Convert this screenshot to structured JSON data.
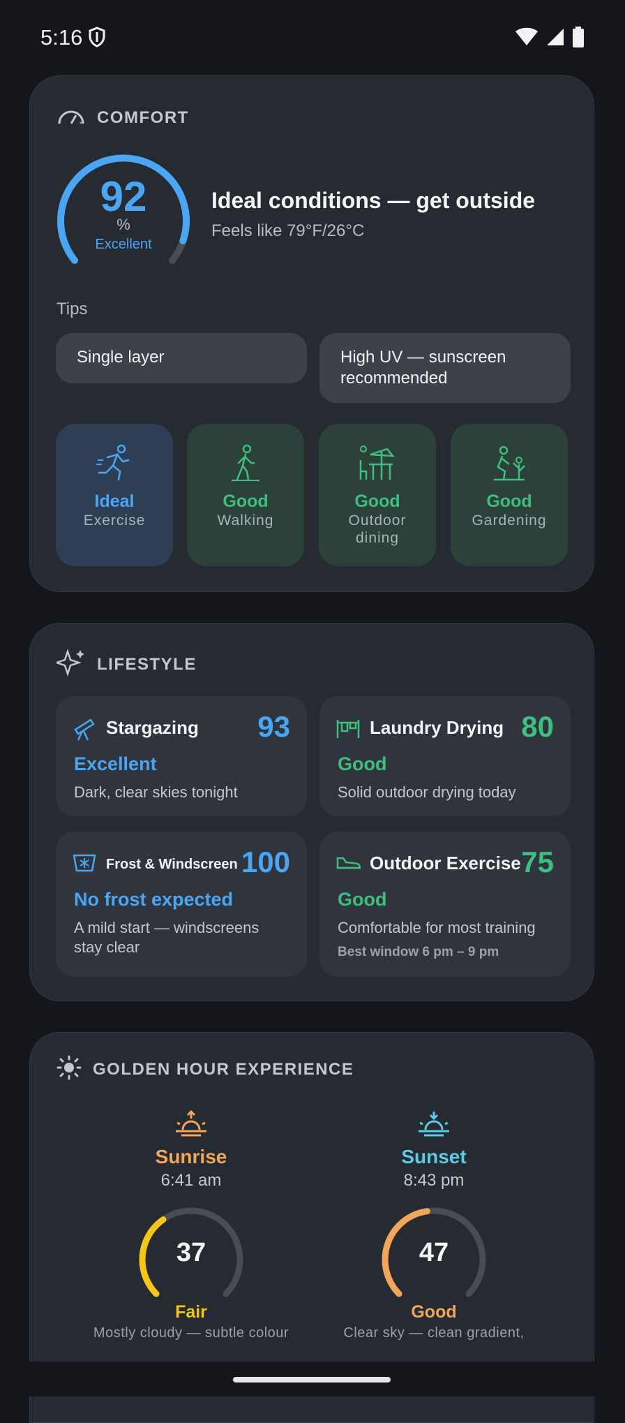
{
  "status_bar": {
    "time": "5:16"
  },
  "comfort": {
    "title": "COMFORT",
    "score": "92",
    "score_fraction": 0.92,
    "unit": "%",
    "rating": "Excellent",
    "headline": "Ideal conditions — get outside",
    "feels_like": "Feels like 79°F/26°C",
    "tips_label": "Tips",
    "tips": [
      "Single layer",
      "High UV — sunscreen recommended"
    ],
    "activities": [
      {
        "status": "Ideal",
        "name": "Exercise",
        "color": "#4aa6f3"
      },
      {
        "status": "Good",
        "name": "Walking",
        "color": "#3fbf7f"
      },
      {
        "status": "Good",
        "name": "Outdoor dining",
        "color": "#3fbf7f"
      },
      {
        "status": "Good",
        "name": "Gardening",
        "color": "#3fbf7f"
      }
    ]
  },
  "lifestyle": {
    "title": "LIFESTYLE",
    "items": [
      {
        "name": "Stargazing",
        "score": "93",
        "status": "Excellent",
        "desc": "Dark, clear skies tonight",
        "color": "#4aa6f3",
        "icon": "telescope-icon"
      },
      {
        "name": "Laundry Drying",
        "score": "80",
        "status": "Good",
        "desc": "Solid outdoor drying today",
        "color": "#3fbf7f",
        "icon": "clothesline-icon"
      },
      {
        "name": "Frost & Windscreen",
        "score": "100",
        "status": "No frost expected",
        "desc": "A mild start — windscreens stay clear",
        "color": "#4aa6f3",
        "icon": "windscreen-icon"
      },
      {
        "name": "Outdoor Exercise",
        "score": "75",
        "status": "Good",
        "desc": "Comfortable for most training",
        "extra": "Best window 6 pm – 9 pm",
        "color": "#3fbf7f",
        "icon": "shoe-icon"
      }
    ]
  },
  "golden_hour": {
    "title": "GOLDEN HOUR EXPERIENCE",
    "sunrise": {
      "label": "Sunrise",
      "time": "6:41 am",
      "score": "37",
      "score_fraction": 0.37,
      "rating": "Fair",
      "desc": "Mostly cloudy — subtle colour",
      "color": "#f2a65a",
      "gauge_color": "#f5c518",
      "rating_color": "#f5c518"
    },
    "sunset": {
      "label": "Sunset",
      "time": "8:43 pm",
      "score": "47",
      "score_fraction": 0.47,
      "rating": "Good",
      "desc": "Clear sky — clean gradient,",
      "color": "#5ccbe6",
      "gauge_color": "#f2a65a",
      "rating_color": "#f2a65a"
    }
  }
}
